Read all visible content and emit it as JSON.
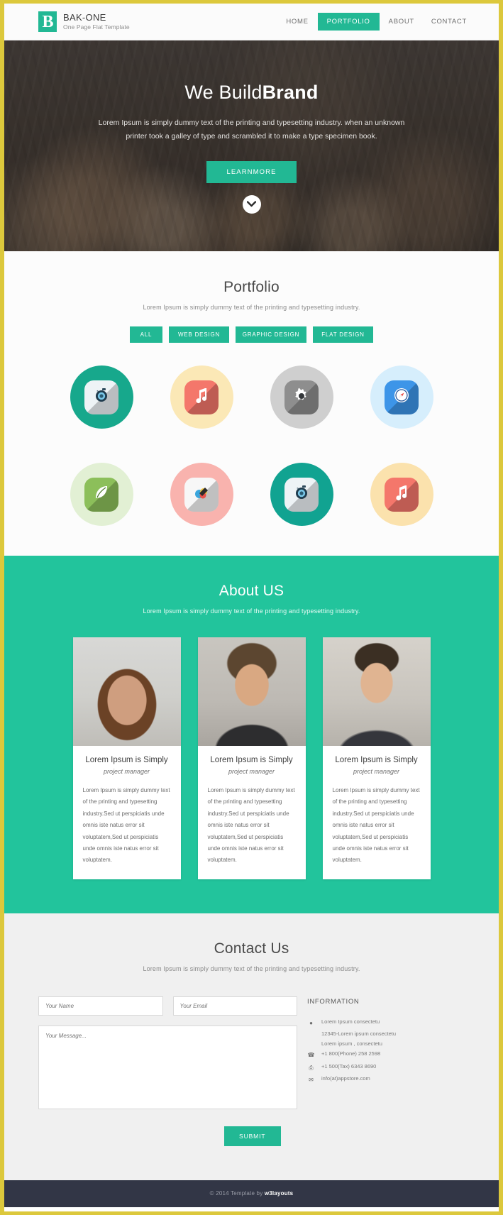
{
  "theme": {
    "accent": "#22b894",
    "about_bg": "#22c49c",
    "page_border": "#dcc83c",
    "footer_bg": "#323646"
  },
  "header": {
    "logo_letter": "B",
    "brand_name": "BAK-ONE",
    "brand_tagline": "One Page Flat Template",
    "nav": [
      {
        "label": "HOME",
        "active": false
      },
      {
        "label": "PORTFOLIO",
        "active": true
      },
      {
        "label": "ABOUT",
        "active": false
      },
      {
        "label": "CONTACT",
        "active": false
      }
    ]
  },
  "hero": {
    "title_light": "We Build",
    "title_bold": "Brand",
    "subtitle": "Lorem Ipsum is simply dummy text of the printing and typesetting industry. when an unknown printer took a galley of type and scrambled it to make a type specimen book.",
    "cta_label": "LEARNMORE",
    "scroll_icon": "chevron-down-icon"
  },
  "portfolio": {
    "title": "Portfolio",
    "subtitle": "Lorem Ipsum is simply dummy text of the printing and typesetting industry.",
    "filters": [
      {
        "label": "ALL"
      },
      {
        "label": "WEB DESIGN"
      },
      {
        "label": "GRAPHIC DESIGN"
      },
      {
        "label": "FLAT DESIGN"
      }
    ],
    "items": [
      {
        "icon": "camera-icon",
        "circle": "#17a88c",
        "badge": "#eef3f6",
        "accent": "#2f4a5c",
        "dark": "#1f3b4d"
      },
      {
        "icon": "music-icon",
        "circle": "#fbe8b6",
        "badge": "#f4776b",
        "accent": "#ffffff",
        "dark": "#b0202e"
      },
      {
        "icon": "gear-icon",
        "circle": "#cfcfcf",
        "badge": "#8e8e8e",
        "accent": "#ffffff",
        "dark": "#34373a"
      },
      {
        "icon": "compass-icon",
        "circle": "#d6eefc",
        "badge": "#3d95e8",
        "accent": "#ffffff",
        "dark": "#1d4f96"
      },
      {
        "icon": "leaf-icon",
        "circle": "#e2f0d4",
        "badge": "#8cbf5a",
        "accent": "#ffffff",
        "dark": "#4d7a2b"
      },
      {
        "icon": "palette-icon",
        "circle": "#f9b3ae",
        "badge": "#f7f7f7",
        "accent": "#3aa6dd",
        "dark": "#2c2c2c"
      },
      {
        "icon": "camera-icon",
        "circle": "#11a391",
        "badge": "#eef3f6",
        "accent": "#2f4a5c",
        "dark": "#1f3b4d"
      },
      {
        "icon": "music-icon",
        "circle": "#fbe2ad",
        "badge": "#f4776b",
        "accent": "#ffffff",
        "dark": "#b0202e"
      }
    ]
  },
  "about": {
    "title": "About US",
    "subtitle": "Lorem Ipsum is simply dummy text of the printing and typesetting industry.",
    "members": [
      {
        "name": "Lorem Ipsum is Simply",
        "role": "project manager",
        "text": "Lorem Ipsum is simply dummy text of the printing and typesetting industry.Sed ut perspiciatis unde omnis iste natus error sit voluptatem,Sed ut perspiciatis unde omnis iste natus error sit voluptatem."
      },
      {
        "name": "Lorem Ipsum is Simply",
        "role": "project manager",
        "text": "Lorem Ipsum is simply dummy text of the printing and typesetting industry.Sed ut perspiciatis unde omnis iste natus error sit voluptatem,Sed ut perspiciatis unde omnis iste natus error sit voluptatem."
      },
      {
        "name": "Lorem Ipsum is Simply",
        "role": "project manager",
        "text": "Lorem Ipsum is simply dummy text of the printing and typesetting industry.Sed ut perspiciatis unde omnis iste natus error sit voluptatem,Sed ut perspiciatis unde omnis iste natus error sit voluptatem."
      }
    ]
  },
  "contact": {
    "title": "Contact Us",
    "subtitle": "Lorem Ipsum is simply dummy text of the printing and typesetting industry.",
    "form": {
      "name_placeholder": "Your Name",
      "email_placeholder": "Your Email",
      "message_placeholder": "Your Message...",
      "submit_label": "SUBMIT"
    },
    "information": {
      "heading": "INFORMATION",
      "address_line1": "Lorem Ipsum consectetu",
      "address_line2": "12345-Lorem ipsum consectetu",
      "address_line3": "Lorem ipsum , consectetu",
      "phone": "+1 800(Phone) 258 2598",
      "fax": "+1 500(Tax) 6343 8690",
      "email": "info(at)appstore.com"
    }
  },
  "footer": {
    "copyright": "© 2014 Template by ",
    "brand": "w3layouts"
  }
}
